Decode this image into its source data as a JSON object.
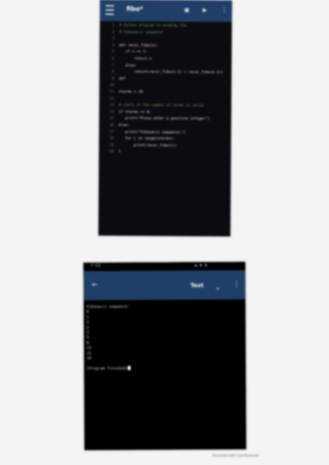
{
  "editor_screen": {
    "app_title": "fibo*",
    "icons": {
      "menu": "hamburger-menu-icon",
      "folder": "folder-icon",
      "run": "run-icon",
      "more": "more-vert-icon"
    },
    "code_lines": [
      {
        "num": "1",
        "text": "# Python program to display the",
        "kind": "comment"
      },
      {
        "num": "2",
        "text": "# Fibonacci sequence",
        "kind": "comment"
      },
      {
        "num": "3",
        "text": "",
        "kind": "code"
      },
      {
        "num": "4",
        "text": "def recur_fibo(n):",
        "kind": "code"
      },
      {
        "num": "5",
        "text": "   if n <= 1:",
        "kind": "code"
      },
      {
        "num": "6",
        "text": "       return n",
        "kind": "code"
      },
      {
        "num": "7",
        "text": "   else:",
        "kind": "code"
      },
      {
        "num": "8",
        "text": "       return(recur_fibo(n-1) + recur_fibo(n-2))",
        "kind": "code"
      },
      {
        "num": "9",
        "text": "def",
        "kind": "code"
      },
      {
        "num": "10",
        "text": "",
        "kind": "code"
      },
      {
        "num": "11",
        "text": "nterms = 10",
        "kind": "code"
      },
      {
        "num": "12",
        "text": "",
        "kind": "code"
      },
      {
        "num": "13",
        "text": "# check if the number of terms is valid",
        "kind": "comment"
      },
      {
        "num": "14",
        "text": "if nterms <= 0:",
        "kind": "code"
      },
      {
        "num": "15",
        "text": "   print(\"Plese enter a positive integer\")",
        "kind": "code"
      },
      {
        "num": "16",
        "text": "else:",
        "kind": "code"
      },
      {
        "num": "17",
        "text": "   print(\"Fibonacci sequence:\")",
        "kind": "code"
      },
      {
        "num": "18",
        "text": "   for i in range(nterms):",
        "kind": "code"
      },
      {
        "num": "19",
        "text": "       print(recur_fibo(i))",
        "kind": "code"
      },
      {
        "num": "20",
        "text": "1",
        "kind": "code"
      }
    ]
  },
  "output_screen": {
    "status_time": "7:53",
    "status_icons": "▲ ◆ ▮",
    "back_icon": "back-arrow-icon",
    "label": "Text",
    "icons": {
      "keyboard": "keyboard-icon",
      "more": "more-vert-icon"
    },
    "lines": [
      "Fibonacci sequence:",
      "0",
      "1",
      "1",
      "2",
      "3",
      "5",
      "8",
      "13",
      "21",
      "34",
      "",
      "[Program finished]"
    ]
  },
  "watermark": "Scanned with CamScanner"
}
